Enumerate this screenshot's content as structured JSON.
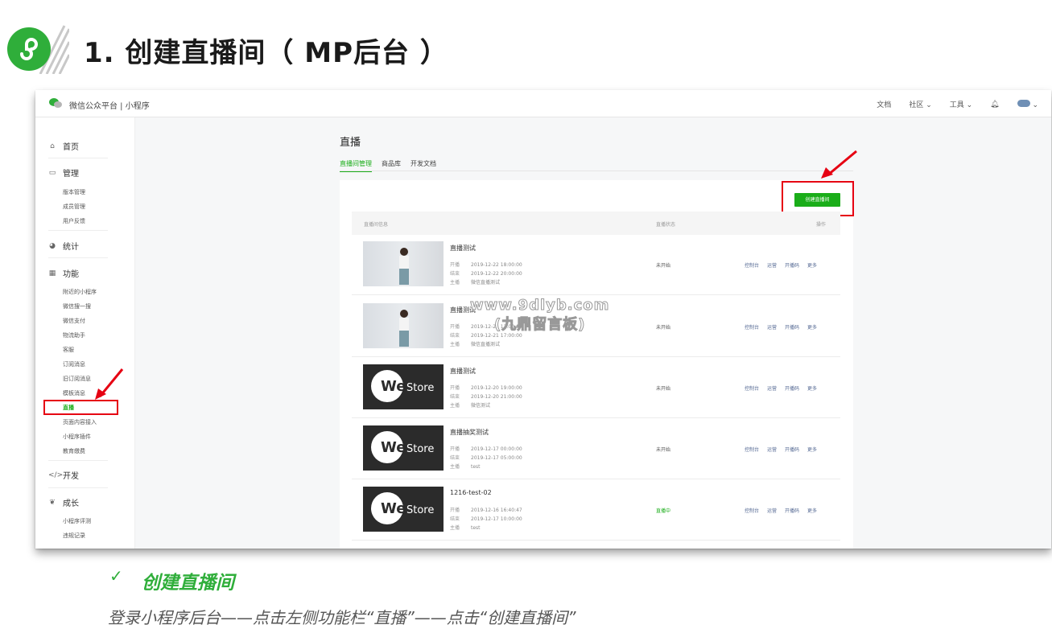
{
  "title": "1. 创建直播间（ MP后台 ）",
  "header": {
    "brand": "微信公众平台 | 小程序",
    "menu": [
      "文档",
      "社区",
      "工具"
    ]
  },
  "sidebar": {
    "groups": [
      {
        "label": "首页",
        "icon": "home-icon"
      },
      {
        "label": "管理",
        "icon": "inbox-icon",
        "items": [
          "版本管理",
          "成员管理",
          "用户反馈"
        ]
      },
      {
        "label": "统计",
        "icon": "pie-chart-icon"
      },
      {
        "label": "功能",
        "icon": "grid-icon",
        "items": [
          "附近的小程序",
          "微信搜一搜",
          "微信支付",
          "物流助手",
          "客服",
          "订阅消息",
          "旧订阅消息",
          "模板消息",
          "直播",
          "页面内容接入",
          "小程序插件",
          "教育缴费"
        ]
      },
      {
        "label": "开发",
        "icon": "code-icon"
      },
      {
        "label": "成长",
        "icon": "growth-icon",
        "items": [
          "小程序评测",
          "违规记录"
        ]
      }
    ],
    "active_item": "直播"
  },
  "main": {
    "title": "直播",
    "tabs": [
      "直播间管理",
      "商品库",
      "开发文档"
    ],
    "create_button": "创建直播间",
    "columns": [
      "直播间信息",
      "直播状态",
      "操作"
    ],
    "meta_labels": [
      "开播",
      "结束",
      "主播"
    ],
    "ops": [
      "控制台",
      "运营",
      "开播码",
      "更多"
    ],
    "rows": [
      {
        "name": "直播测试",
        "start": "2019-12-22 18:00:00",
        "end": "2019-12-22 20:00:00",
        "host": "微信直播测试",
        "status": "未开始",
        "thumb": "photo"
      },
      {
        "name": "直播测试",
        "start": "2019-12-21 12:00:00",
        "end": "2019-12-21 17:00:00",
        "host": "微信直播测试",
        "status": "未开始",
        "thumb": "photo"
      },
      {
        "name": "直播测试",
        "start": "2019-12-20 19:00:00",
        "end": "2019-12-20 21:00:00",
        "host": "微信测试",
        "status": "未开始",
        "thumb": "westore"
      },
      {
        "name": "直播抽奖测试",
        "start": "2019-12-17 00:00:00",
        "end": "2019-12-17 05:00:00",
        "host": "test",
        "status": "未开始",
        "thumb": "westore"
      },
      {
        "name": "1216-test-02",
        "start": "2019-12-16 16:40:47",
        "end": "2019-12-17 10:00:00",
        "host": "test",
        "status": "直播中",
        "thumb": "westore"
      }
    ],
    "thumb_text": {
      "we": "We",
      "store": "Store"
    }
  },
  "watermark": [
    "www.9dlyb.com",
    "(九鼎留言板)"
  ],
  "caption": {
    "check": "✓",
    "title": "创建直播间",
    "text": "登录小程序后台——点击左侧功能栏“直播”——点击“创建直播间”"
  },
  "colors": {
    "accent": "#1aad19",
    "highlight": "#e60012",
    "caption": "#2fae3a"
  }
}
